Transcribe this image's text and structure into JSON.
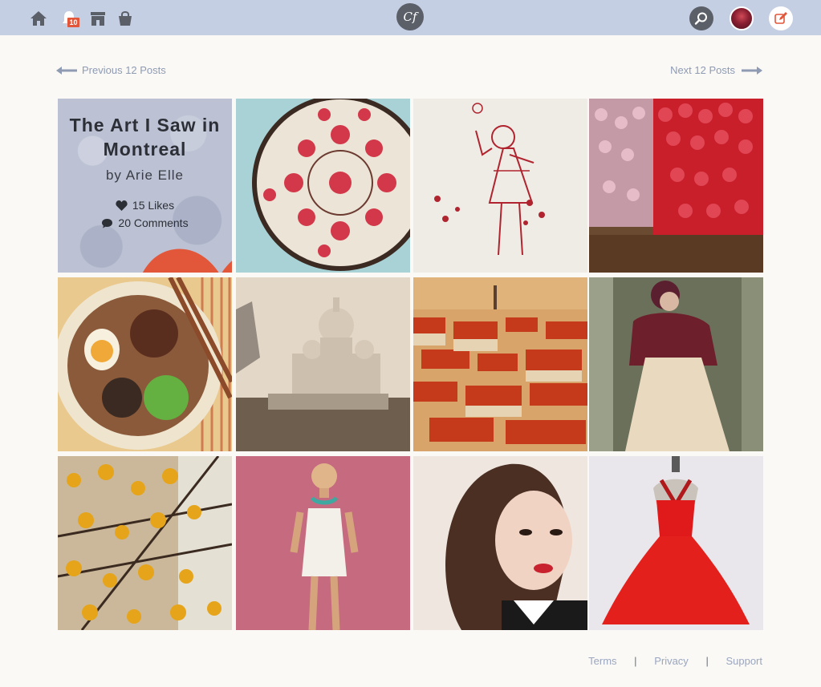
{
  "header": {
    "notifications_count": "10",
    "logo_text": "Cf",
    "icons": [
      "home-icon",
      "bell-icon",
      "store-icon",
      "shopping-bag-icon",
      "search-icon",
      "avatar",
      "compose-icon"
    ]
  },
  "pager": {
    "previous_label": "Previous 12 Posts",
    "next_label": "Next 12 Posts"
  },
  "feature": {
    "title": "The Art I Saw in Montreal",
    "author": "by Arie Elle",
    "likes": "15 Likes",
    "comments": "20 Comments"
  },
  "tiles": [
    "embroidery-hoop",
    "embroidered-girl",
    "tulips",
    "ramen-bowl",
    "sacre-coeur",
    "red-rooftops",
    "burgundy-fur-dress",
    "yellow-flowers",
    "white-dress-model",
    "vintage-portrait",
    "red-dress"
  ],
  "colors": {
    "topbar": "#c5cfe3",
    "accent": "#e2573a",
    "link": "#8f9bb3"
  },
  "footer": {
    "terms": "Terms",
    "privacy": "Privacy",
    "support": "Support"
  }
}
